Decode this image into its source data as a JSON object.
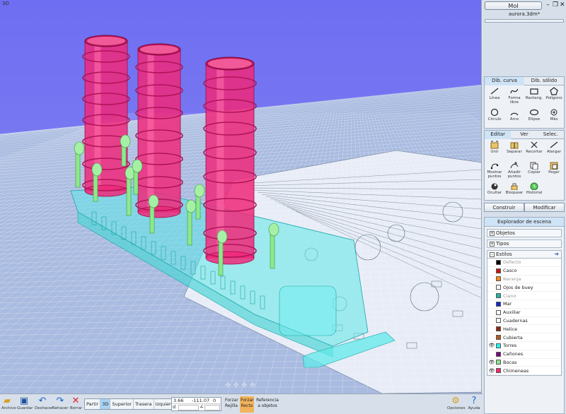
{
  "viewport": {
    "label": "3D"
  },
  "panel": {
    "app_title": "MoI",
    "filename": "aurora.3dm*",
    "window_controls": [
      "minimize-icon",
      "restore-icon",
      "close-icon"
    ],
    "draw_tabs": [
      {
        "label": "Dib. curva",
        "active": true
      },
      {
        "label": "Dib. sólido",
        "active": false
      }
    ],
    "draw_tools": [
      {
        "label": "Línea",
        "icon": "line-icon"
      },
      {
        "label": "Forma libre",
        "icon": "freeform-icon"
      },
      {
        "label": "Rectang.",
        "icon": "rectangle-icon"
      },
      {
        "label": "Polígono",
        "icon": "polygon-icon"
      },
      {
        "label": "Círculo",
        "icon": "circle-icon"
      },
      {
        "label": "Arco",
        "icon": "arc-icon"
      },
      {
        "label": "Elipse",
        "icon": "ellipse-icon"
      },
      {
        "label": "Más",
        "icon": "more-icon"
      }
    ],
    "edit_tabs": [
      {
        "label": "Editar",
        "active": true
      },
      {
        "label": "Ver",
        "active": false
      },
      {
        "label": "Selec.",
        "active": false
      }
    ],
    "edit_tools": [
      {
        "label": "Unir",
        "icon": "join-icon"
      },
      {
        "label": "Separar",
        "icon": "separate-icon"
      },
      {
        "label": "Recortar",
        "icon": "trim-icon"
      },
      {
        "label": "Alargar",
        "icon": "extend-icon"
      },
      {
        "label": "Mostrar puntos",
        "icon": "show-points-icon"
      },
      {
        "label": "Añadir puntos",
        "icon": "add-points-icon"
      },
      {
        "label": "Copiar",
        "icon": "copy-icon"
      },
      {
        "label": "Pegar",
        "icon": "paste-icon"
      },
      {
        "label": "Ocultar",
        "icon": "hide-icon"
      },
      {
        "label": "Bloquear",
        "icon": "lock-icon"
      },
      {
        "label": "Historial",
        "icon": "history-icon"
      }
    ],
    "construct_label": "Construir",
    "modify_label": "Modificar",
    "scene": {
      "title": "Explorador de escena",
      "objects_label": "Objetos",
      "types_label": "Tipos",
      "styles_label": "Estilos",
      "styles": [
        {
          "name": "Defecto",
          "color": "#000000",
          "visible": false,
          "dim": true
        },
        {
          "name": "Casco",
          "color": "#c81414",
          "visible": false,
          "dim": false
        },
        {
          "name": "Naranja",
          "color": "#ff8c1e",
          "visible": false,
          "dim": true
        },
        {
          "name": "Ojos de buey",
          "color": "#ffffff",
          "visible": false,
          "dim": false
        },
        {
          "name": "Ciano",
          "color": "#1eb4a0",
          "visible": false,
          "dim": true
        },
        {
          "name": "Mar",
          "color": "#1428c8",
          "visible": false,
          "dim": false
        },
        {
          "name": "Auxiliar",
          "color": "#ffffff",
          "visible": false,
          "dim": false
        },
        {
          "name": "Cuadernas",
          "color": "#ffffff",
          "visible": false,
          "dim": false
        },
        {
          "name": "Helice",
          "color": "#8c2814",
          "visible": false,
          "dim": false
        },
        {
          "name": "Cubierta",
          "color": "#b45a1e",
          "visible": false,
          "dim": false
        },
        {
          "name": "Torres",
          "color": "#28f0f0",
          "visible": true,
          "dim": false
        },
        {
          "name": "Cañones",
          "color": "#780a78",
          "visible": false,
          "dim": false
        },
        {
          "name": "Bocas",
          "color": "#8ce68c",
          "visible": true,
          "dim": false
        },
        {
          "name": "Chimeneas",
          "color": "#f0286e",
          "visible": true,
          "dim": false
        }
      ]
    }
  },
  "bottom": {
    "archivo": "Archivo",
    "guardar": "Guardar",
    "deshacer": "Deshacer",
    "rehacer": "Rehacer",
    "borrar": "Borrar",
    "views": [
      {
        "label": "Partir",
        "active": false
      },
      {
        "label": "3D",
        "active": true
      },
      {
        "label": "Superior",
        "active": false
      },
      {
        "label": "Trasera",
        "active": false
      },
      {
        "label": "Izquierda",
        "active": false
      }
    ],
    "coord_x": "3.66",
    "coord_y": "-111.07",
    "coord_z": "0",
    "coord_d_label": "d",
    "flags": [
      {
        "line1": "Forzar",
        "line2": "Rejilla",
        "on": false
      },
      {
        "line1": "Forzar",
        "line2": "Recto",
        "on": true
      },
      {
        "line1": "Referencia",
        "line2": "a objetos",
        "on": false
      }
    ],
    "opciones": "Opciones",
    "ayuda": "Ayuda"
  },
  "colors": {
    "sky": "#6b6bf0",
    "ground": "#9fb4de",
    "funnel": "#f0287a",
    "turret": "#60f0f0",
    "vent": "#8ee88e",
    "accent": "#a9d3f5"
  }
}
